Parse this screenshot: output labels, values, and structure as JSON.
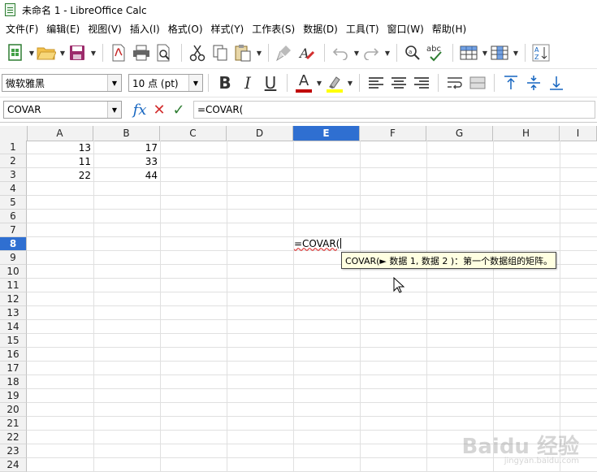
{
  "window": {
    "title": "未命名 1 - LibreOffice Calc"
  },
  "menu": [
    "文件(F)",
    "编辑(E)",
    "视图(V)",
    "插入(I)",
    "格式(O)",
    "样式(Y)",
    "工作表(S)",
    "数据(D)",
    "工具(T)",
    "窗口(W)",
    "帮助(H)"
  ],
  "toolbar": {
    "font_name": "微软雅黑",
    "font_size": "10 点 (pt)",
    "bold_label": "B",
    "italic_label": "I",
    "underline_label": "U",
    "font_color_label": "A",
    "font_color": "#c00000",
    "highlight_color": "#ffff00",
    "spelling_label": "abc"
  },
  "formula_bar": {
    "name_box": "COVAR",
    "fx_label": "fx",
    "cancel_symbol": "✕",
    "accept_symbol": "✓",
    "formula": "=COVAR("
  },
  "sheet": {
    "columns": [
      "A",
      "B",
      "C",
      "D",
      "E",
      "F",
      "G",
      "H",
      "I"
    ],
    "selected_column": "E",
    "rows": [
      "1",
      "2",
      "3",
      "4",
      "5",
      "6",
      "7",
      "8",
      "9",
      "10",
      "11",
      "12",
      "13",
      "14",
      "15",
      "16",
      "17",
      "18",
      "19",
      "20",
      "21",
      "22",
      "23",
      "24"
    ],
    "selected_row": "8",
    "cells": {
      "A1": "13",
      "B1": "17",
      "A2": "11",
      "B2": "33",
      "A3": "22",
      "B3": "44"
    },
    "editing_text": "=COVAR(",
    "tooltip": "COVAR(► 数据 1, 数据 2 )：第一个数据组的矩阵。"
  },
  "watermark": {
    "line1": "Baidu 经验",
    "line2": "jingyan.baidu.com"
  },
  "colors": {
    "selection": "#2f6fd1",
    "tooltip_bg": "#ffffe1"
  }
}
